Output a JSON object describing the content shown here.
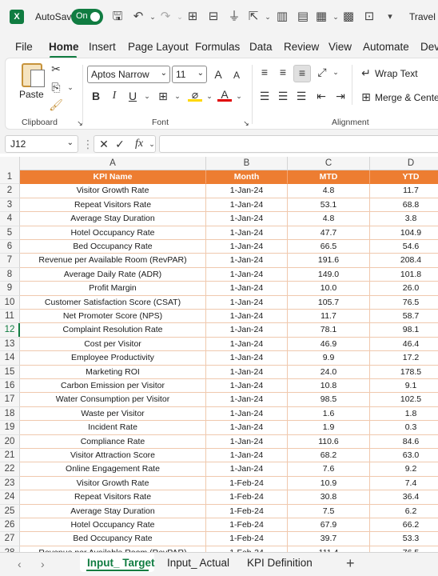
{
  "titlebar": {
    "autosave_label": "AutoSave",
    "autosave_state": "On",
    "document_title": "Travel &",
    "accent_color": "#107c41",
    "icons": [
      "save-icon",
      "undo-icon",
      "redo-icon",
      "table-icon",
      "form-icon",
      "filter-icon",
      "share-icon",
      "chart-icon",
      "format-icon",
      "calculator-icon",
      "preview-icon",
      "dropdown-icon"
    ]
  },
  "menu": {
    "tabs": [
      "File",
      "Home",
      "Insert",
      "Page Layout",
      "Formulas",
      "Data",
      "Review",
      "View",
      "Automate",
      "Dev"
    ],
    "active": "Home"
  },
  "ribbon": {
    "clipboard": {
      "paste_label": "Paste",
      "group_label": "Clipboard"
    },
    "font": {
      "font_name": "Aptos Narrow",
      "font_size": "11",
      "group_label": "Font"
    },
    "alignment": {
      "wrap_text_label": "Wrap Text",
      "merge_center_label": "Merge & Center",
      "group_label": "Alignment"
    }
  },
  "formula_bar": {
    "name_box": "J12",
    "fx_label": "fx",
    "formula": ""
  },
  "sheet": {
    "columns": [
      "A",
      "B",
      "C",
      "D"
    ],
    "header_color": "#ed7d31",
    "selected_row": 12,
    "row_numbers": [
      "1",
      "2",
      "3",
      "4",
      "5",
      "6",
      "7",
      "8",
      "9",
      "10",
      "11",
      "12",
      "13",
      "14",
      "15",
      "16",
      "17",
      "18",
      "19",
      "20",
      "21",
      "22",
      "23",
      "24",
      "25",
      "26",
      "27",
      "28"
    ],
    "header": [
      "KPI Name",
      "Month",
      "MTD",
      "YTD"
    ],
    "rows": [
      [
        "Visitor Growth Rate",
        "1-Jan-24",
        "4.8",
        "11.7"
      ],
      [
        "Repeat Visitors Rate",
        "1-Jan-24",
        "53.1",
        "68.8"
      ],
      [
        "Average Stay Duration",
        "1-Jan-24",
        "4.8",
        "3.8"
      ],
      [
        "Hotel Occupancy Rate",
        "1-Jan-24",
        "47.7",
        "104.9"
      ],
      [
        "Bed Occupancy Rate",
        "1-Jan-24",
        "66.5",
        "54.6"
      ],
      [
        "Revenue per Available Room (RevPAR)",
        "1-Jan-24",
        "191.6",
        "208.4"
      ],
      [
        "Average Daily Rate (ADR)",
        "1-Jan-24",
        "149.0",
        "101.8"
      ],
      [
        "Profit Margin",
        "1-Jan-24",
        "10.0",
        "26.0"
      ],
      [
        "Customer Satisfaction Score (CSAT)",
        "1-Jan-24",
        "105.7",
        "76.5"
      ],
      [
        "Net Promoter Score (NPS)",
        "1-Jan-24",
        "11.7",
        "58.7"
      ],
      [
        "Complaint Resolution Rate",
        "1-Jan-24",
        "78.1",
        "98.1"
      ],
      [
        "Cost per Visitor",
        "1-Jan-24",
        "46.9",
        "46.4"
      ],
      [
        "Employee Productivity",
        "1-Jan-24",
        "9.9",
        "17.2"
      ],
      [
        "Marketing ROI",
        "1-Jan-24",
        "24.0",
        "178.5"
      ],
      [
        "Carbon Emission per Visitor",
        "1-Jan-24",
        "10.8",
        "9.1"
      ],
      [
        "Water Consumption per Visitor",
        "1-Jan-24",
        "98.5",
        "102.5"
      ],
      [
        "Waste per Visitor",
        "1-Jan-24",
        "1.6",
        "1.8"
      ],
      [
        "Incident Rate",
        "1-Jan-24",
        "1.9",
        "0.3"
      ],
      [
        "Compliance Rate",
        "1-Jan-24",
        "110.6",
        "84.6"
      ],
      [
        "Visitor Attraction Score",
        "1-Jan-24",
        "68.2",
        "63.0"
      ],
      [
        "Online Engagement Rate",
        "1-Jan-24",
        "7.6",
        "9.2"
      ],
      [
        "Visitor Growth Rate",
        "1-Feb-24",
        "10.9",
        "7.4"
      ],
      [
        "Repeat Visitors Rate",
        "1-Feb-24",
        "30.8",
        "36.4"
      ],
      [
        "Average Stay Duration",
        "1-Feb-24",
        "7.5",
        "6.2"
      ],
      [
        "Hotel Occupancy Rate",
        "1-Feb-24",
        "67.9",
        "66.2"
      ],
      [
        "Bed Occupancy Rate",
        "1-Feb-24",
        "39.7",
        "53.3"
      ],
      [
        "Revenue per Available Room (RevPAR)",
        "1-Feb-24",
        "111.4",
        "76.5"
      ]
    ]
  },
  "sheet_tabs": {
    "tabs": [
      "Input_ Target",
      "Input_ Actual",
      "KPI Definition"
    ],
    "active": "Input_ Target"
  }
}
